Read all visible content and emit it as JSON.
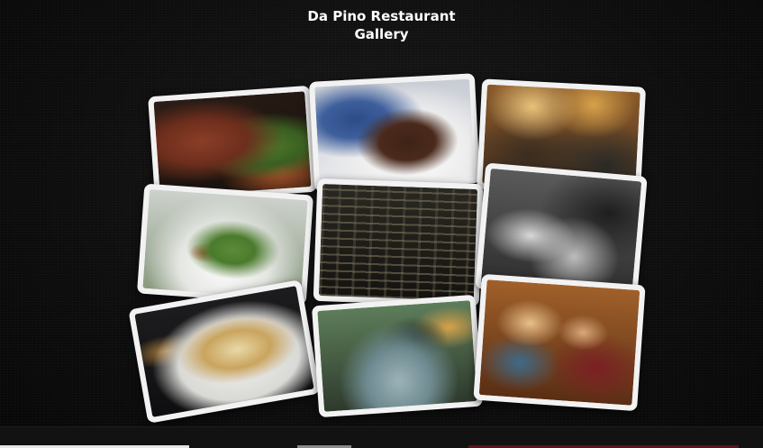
{
  "header": {
    "title_line1": "Da Pino Restaurant",
    "title_line2": "Gallery"
  },
  "gallery": {
    "photos": [
      {
        "subject": "steak-with-asparagus",
        "colors": [
          "#3a2418",
          "#7b3b25",
          "#a9553a",
          "#4f7a2a"
        ]
      },
      {
        "subject": "chocolate-cake-dessert",
        "colors": [
          "#dcdfe6",
          "#2d4c86",
          "#4a2a1c",
          "#fafafa"
        ]
      },
      {
        "subject": "party-guests-toasting",
        "colors": [
          "#6b4a24",
          "#c98a3b",
          "#2b2a26",
          "#e8c27a"
        ]
      },
      {
        "subject": "fresh-salad-bowl",
        "colors": [
          "#e9ece8",
          "#5c8b3a",
          "#c53a2a",
          "#8a9a80"
        ]
      },
      {
        "subject": "wine-cellar-shelves",
        "colors": [
          "#1a1a18",
          "#4b4538",
          "#8b7f66",
          "#2a2822"
        ]
      },
      {
        "subject": "chef-kitchen-black-white",
        "colors": [
          "#3a3a3a",
          "#9a9a9a",
          "#d8d8d8",
          "#1e1e1e"
        ]
      },
      {
        "subject": "spaghetti-carbonara-plate",
        "colors": [
          "#1c1c1e",
          "#e9d8a8",
          "#c9a45e",
          "#f0f0ee"
        ]
      },
      {
        "subject": "champagne-in-ice-bucket",
        "colors": [
          "#2e3a2c",
          "#9cb2b8",
          "#d6a24a",
          "#5d7d5a"
        ]
      },
      {
        "subject": "diners-smiling-at-table",
        "colors": [
          "#6b3a1c",
          "#c27a3e",
          "#7b1f24",
          "#e8c08a"
        ]
      }
    ]
  }
}
